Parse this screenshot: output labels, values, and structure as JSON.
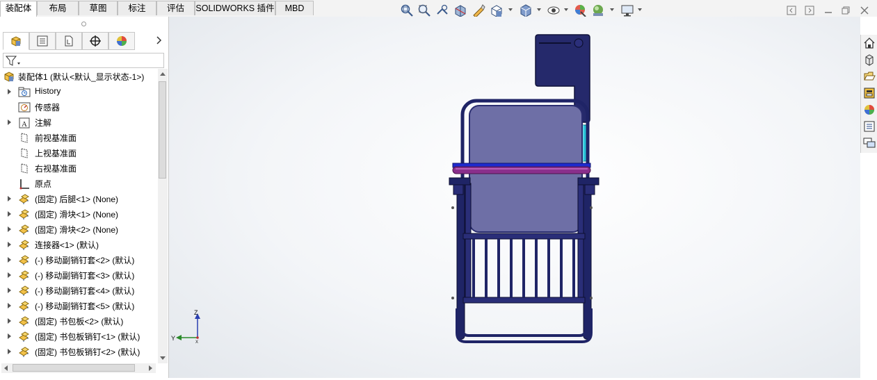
{
  "tabs": [
    {
      "label": "装配体",
      "active": true
    },
    {
      "label": "布局",
      "active": false
    },
    {
      "label": "草图",
      "active": false
    },
    {
      "label": "标注",
      "active": false
    },
    {
      "label": "评估",
      "active": false
    },
    {
      "label": "SOLIDWORKS 插件",
      "active": false
    },
    {
      "label": "MBD",
      "active": false
    }
  ],
  "view_toolbar": [
    "zoom-to-fit-icon",
    "zoom-to-area-icon",
    "previous-view-icon",
    "section-view-icon",
    "dynamic-annotation-icon",
    "view-orientation-icon",
    "display-style-icon",
    "hide-show-items-icon",
    "edit-appearance-icon",
    "apply-scene-icon",
    "view-settings-icon"
  ],
  "panel_tabs": [
    "featuremanager-tab",
    "propertymanager-tab",
    "configurationmanager-tab",
    "dimxpertmanager-tab",
    "displaymanager-tab"
  ],
  "tree": {
    "root": "装配体1  (默认<默认_显示状态-1>)",
    "items": [
      {
        "label": "History",
        "icon": "history-folder-icon",
        "expandable": true
      },
      {
        "label": "传感器",
        "icon": "sensor-icon",
        "expandable": false
      },
      {
        "label": "注解",
        "icon": "annotation-icon",
        "expandable": true
      },
      {
        "label": "前视基准面",
        "icon": "plane-icon",
        "expandable": false
      },
      {
        "label": "上视基准面",
        "icon": "plane-icon",
        "expandable": false
      },
      {
        "label": "右视基准面",
        "icon": "plane-icon",
        "expandable": false
      },
      {
        "label": "原点",
        "icon": "origin-icon",
        "expandable": false
      },
      {
        "label": "(固定) 后腿<1> (None)",
        "icon": "part-icon",
        "expandable": true
      },
      {
        "label": "(固定) 滑块<1> (None)",
        "icon": "part-icon",
        "expandable": true
      },
      {
        "label": "(固定) 滑块<2> (None)",
        "icon": "part-icon",
        "expandable": true
      },
      {
        "label": "连接器<1> (默认)",
        "icon": "part-icon",
        "expandable": true
      },
      {
        "label": "(-) 移动副销钉套<2> (默认)",
        "icon": "part-icon",
        "expandable": true
      },
      {
        "label": "(-) 移动副销钉套<3> (默认)",
        "icon": "part-icon",
        "expandable": true
      },
      {
        "label": "(-) 移动副销钉套<4> (默认)",
        "icon": "part-icon",
        "expandable": true
      },
      {
        "label": "(-) 移动副销钉套<5> (默认)",
        "icon": "part-icon",
        "expandable": true
      },
      {
        "label": "(固定) 书包板<2> (默认)",
        "icon": "part-icon",
        "expandable": true
      },
      {
        "label": "(固定) 书包板销钉<1> (默认)",
        "icon": "part-icon",
        "expandable": true
      },
      {
        "label": "(固定) 书包板销钉<2> (默认)",
        "icon": "part-icon",
        "expandable": true
      }
    ]
  },
  "triad": {
    "z": "Z",
    "y": "Y",
    "x": "X"
  },
  "task_pane": [
    "home-icon",
    "design-library-icon",
    "file-explorer-icon",
    "view-palette-icon",
    "appearances-icon",
    "custom-properties-icon",
    "forum-icon"
  ],
  "colors": {
    "chair_frame": "#1f2466",
    "seat_panel": "#6e6fa6",
    "handle": "#8a2f8c",
    "cylinder": "#29c4d8"
  }
}
